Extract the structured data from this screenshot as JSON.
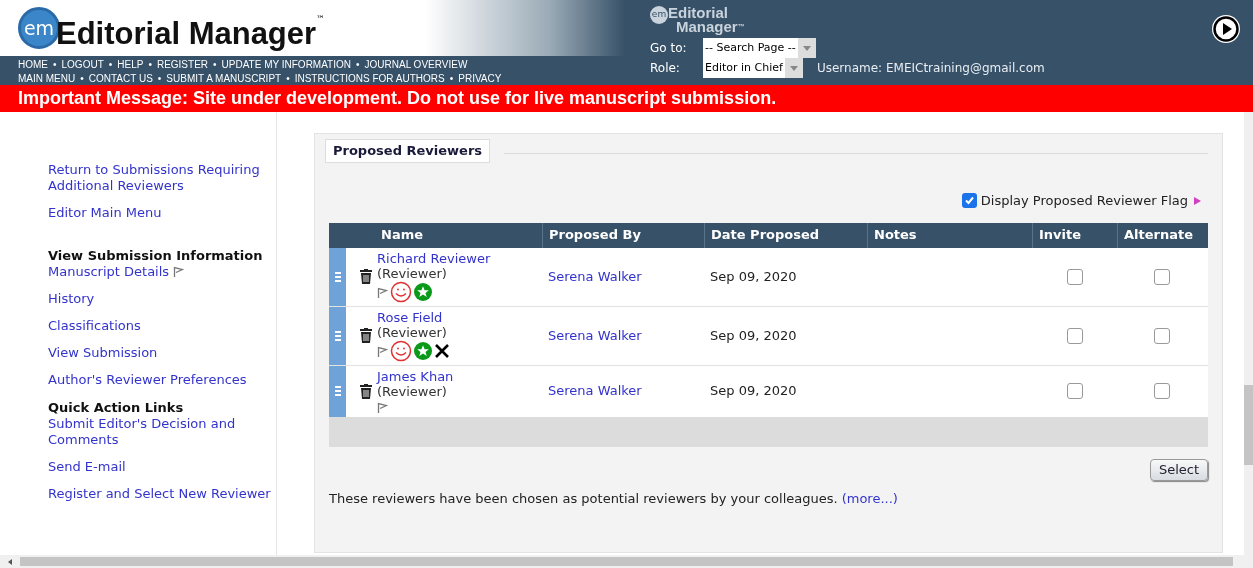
{
  "header": {
    "logo": {
      "badge": "em",
      "title": "Editorial Manager",
      "tm": "™"
    },
    "small_logo": {
      "badge": "em",
      "line1": "Editorial",
      "line2": "Manager",
      "tm": "™"
    },
    "nav": {
      "separator": "•",
      "lines": [
        {
          "links": [
            "HOME",
            "LOGOUT",
            "HELP",
            "REGISTER",
            "UPDATE MY INFORMATION",
            "JOURNAL OVERVIEW"
          ]
        },
        {
          "links": [
            "MAIN MENU",
            "CONTACT US",
            "SUBMIT A MANUSCRIPT",
            "INSTRUCTIONS FOR AUTHORS",
            "PRIVACY"
          ]
        }
      ]
    },
    "goto": {
      "label": "Go to:",
      "value": "-- Search Page --"
    },
    "role": {
      "label": "Role:",
      "value": "Editor in Chief"
    },
    "username": "Username: EMEICtraining@gmail.com"
  },
  "alert": "Important Message: Site under development. Do not use for live manuscript submission.",
  "sidebar": [
    {
      "kind": "link",
      "text": "Return to Submissions Requiring Additional Reviewers"
    },
    {
      "kind": "link",
      "text": "Editor Main Menu"
    },
    {
      "kind": "heading",
      "text": "View Submission Information"
    },
    {
      "kind": "link",
      "text": "Manuscript Details",
      "flag": true
    },
    {
      "kind": "link",
      "text": "History"
    },
    {
      "kind": "link",
      "text": "Classifications"
    },
    {
      "kind": "link",
      "text": "View Submission"
    },
    {
      "kind": "link",
      "text": "Author's Reviewer Preferences"
    },
    {
      "kind": "heading",
      "text": "Quick Action Links"
    },
    {
      "kind": "link",
      "text": "Submit Editor's Decision and Comments"
    },
    {
      "kind": "link",
      "text": "Send E-mail"
    },
    {
      "kind": "link",
      "text": "Register and Select New Reviewer"
    }
  ],
  "panel": {
    "legend": "Proposed Reviewers",
    "display_flag": {
      "label": "Display Proposed Reviewer Flag",
      "checked": true
    },
    "table": {
      "columns": [
        "Name",
        "Proposed By",
        "Date Proposed",
        "Notes",
        "Invite",
        "Alternate"
      ],
      "rows": [
        {
          "name": "Richard Reviewer",
          "role": "(Reviewer)",
          "badges": [
            {
              "kind": "flag"
            },
            {
              "kind": "smiley"
            },
            {
              "kind": "star"
            }
          ],
          "proposed_by": "Serena Walker",
          "date": "Sep 09, 2020",
          "invite": false,
          "alternate": false
        },
        {
          "name": "Rose Field",
          "role": "(Reviewer)",
          "badges": [
            {
              "kind": "flag"
            },
            {
              "kind": "smiley"
            },
            {
              "kind": "star"
            },
            {
              "kind": "cross"
            }
          ],
          "proposed_by": "Serena Walker",
          "date": "Sep 09, 2020",
          "invite": false,
          "alternate": false
        },
        {
          "name": "James Khan",
          "role": "(Reviewer)",
          "badges": [
            {
              "kind": "flag"
            }
          ],
          "proposed_by": "Serena Walker",
          "date": "Sep 09, 2020",
          "invite": false,
          "alternate": false
        }
      ]
    },
    "select_button": "Select",
    "footer": "These reviewers have been chosen as potential reviewers by your colleagues.",
    "more_link": "(more...)"
  }
}
